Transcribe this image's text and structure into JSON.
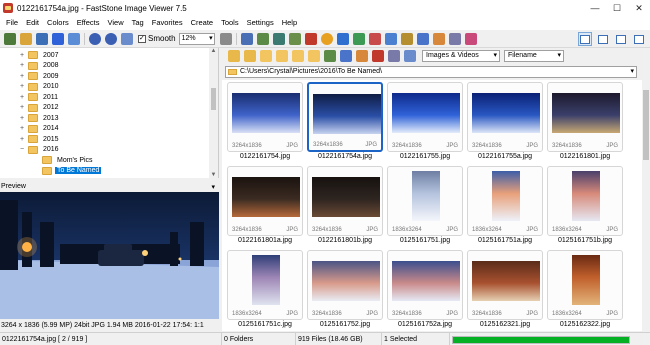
{
  "window": {
    "title": "0122161754a.jpg  -  FastStone Image Viewer 7.5",
    "controls": [
      "—",
      "☐",
      "✕"
    ]
  },
  "menu": [
    "File",
    "Edit",
    "Colors",
    "Effects",
    "View",
    "Tag",
    "Favorites",
    "Create",
    "Tools",
    "Settings",
    "Help"
  ],
  "toolbar": {
    "smooth_label": "Smooth",
    "smooth_checked": true,
    "zoom": "12%",
    "filter": "Images & Videos",
    "sort": "Filename"
  },
  "tree": {
    "items": [
      {
        "label": "2007",
        "expander": "+"
      },
      {
        "label": "2008",
        "expander": "+"
      },
      {
        "label": "2009",
        "expander": "+"
      },
      {
        "label": "2010",
        "expander": "+"
      },
      {
        "label": "2011",
        "expander": "+"
      },
      {
        "label": "2012",
        "expander": "+"
      },
      {
        "label": "2013",
        "expander": "+"
      },
      {
        "label": "2014",
        "expander": "+"
      },
      {
        "label": "2015",
        "expander": "+"
      },
      {
        "label": "2016",
        "expander": "−"
      },
      {
        "label": "Mom's Pics",
        "expander": ""
      },
      {
        "label": "To Be Named",
        "expander": "",
        "selected": true
      }
    ]
  },
  "preview": {
    "header": "Preview",
    "info": "3264 x 1836 (5.99 MP)  24bit  JPG   1.94 MB   2016-01-22 17:54:  1:1"
  },
  "path": "C:\\Users\\Crystal\\Pictures\\2016\\To Be Named\\",
  "thumbnails": [
    {
      "name": "0122161754.jpg",
      "dims": "3264x1836",
      "fmt": "JPG",
      "orient": "landscape",
      "selected": false,
      "palette": [
        "#1a2e70",
        "#3f63c9",
        "#d9e0f5"
      ]
    },
    {
      "name": "0122161754a.jpg",
      "dims": "3264x1836",
      "fmt": "JPG",
      "orient": "landscape",
      "selected": true,
      "palette": [
        "#0f1d44",
        "#2a4ea6",
        "#c7d3ef"
      ]
    },
    {
      "name": "0122161755.jpg",
      "dims": "3264x1836",
      "fmt": "JPG",
      "orient": "landscape",
      "selected": false,
      "palette": [
        "#0e2a8a",
        "#2f62d8",
        "#e3ecfa"
      ]
    },
    {
      "name": "0122161755a.jpg",
      "dims": "3264x1836",
      "fmt": "JPG",
      "orient": "landscape",
      "selected": false,
      "palette": [
        "#0a2175",
        "#2957c2",
        "#dde6f8"
      ]
    },
    {
      "name": "0122161801.jpg",
      "dims": "3264x1836",
      "fmt": "JPG",
      "orient": "landscape",
      "selected": false,
      "palette": [
        "#1d1a2e",
        "#3a3f6a",
        "#c8a873"
      ]
    },
    {
      "name": "0122161801a.jpg",
      "dims": "3264x1836",
      "fmt": "JPG",
      "orient": "landscape",
      "selected": false,
      "palette": [
        "#1b130f",
        "#3b2b22",
        "#b66a3b"
      ]
    },
    {
      "name": "0122161801b.jpg",
      "dims": "3264x1836",
      "fmt": "JPG",
      "orient": "landscape",
      "selected": false,
      "palette": [
        "#16120f",
        "#2e2520",
        "#6a4a35"
      ]
    },
    {
      "name": "0125161751.jpg",
      "dims": "1836x3264",
      "fmt": "JPG",
      "orient": "portrait",
      "selected": false,
      "palette": [
        "#6e7fa3",
        "#b5c3de",
        "#f4f6fb"
      ]
    },
    {
      "name": "0125161751a.jpg",
      "dims": "1836x3264",
      "fmt": "JPG",
      "orient": "portrait",
      "selected": false,
      "palette": [
        "#3d5ea8",
        "#e8a07a",
        "#eef2fa"
      ]
    },
    {
      "name": "0125161751b.jpg",
      "dims": "1836x3264",
      "fmt": "JPG",
      "orient": "portrait",
      "selected": false,
      "palette": [
        "#4a3f6a",
        "#d78a7a",
        "#e6e8f2"
      ]
    },
    {
      "name": "0125161751c.jpg",
      "dims": "1836x3264",
      "fmt": "JPG",
      "orient": "portrait",
      "selected": false,
      "palette": [
        "#2f3f78",
        "#9e86b6",
        "#dfe3ef"
      ]
    },
    {
      "name": "0125161752.jpg",
      "dims": "3264x1836",
      "fmt": "JPG",
      "orient": "landscape",
      "selected": false,
      "palette": [
        "#4a5585",
        "#d89a8a",
        "#e9ecf4"
      ]
    },
    {
      "name": "0125161752a.jpg",
      "dims": "3264x1836",
      "fmt": "JPG",
      "orient": "landscape",
      "selected": false,
      "palette": [
        "#3b4e8e",
        "#c98a8a",
        "#e5e9f4"
      ]
    },
    {
      "name": "0125162321.jpg",
      "dims": "3264x1836",
      "fmt": "JPG",
      "orient": "landscape",
      "selected": false,
      "palette": [
        "#5a2c1a",
        "#a8512f",
        "#e6d0b3"
      ]
    },
    {
      "name": "0125162322.jpg",
      "dims": "1836x3264",
      "fmt": "JPG",
      "orient": "portrait",
      "selected": false,
      "palette": [
        "#6a2a14",
        "#c1602c",
        "#e2b47a"
      ]
    }
  ],
  "status": {
    "position": "0122161754a.jpg  [ 2 / 919 ]",
    "folders": "0 Folders",
    "files": "919 Files (18.46 GB)",
    "selected": "1 Selected",
    "progress": 1.0,
    "progress_color": "#06b025"
  }
}
